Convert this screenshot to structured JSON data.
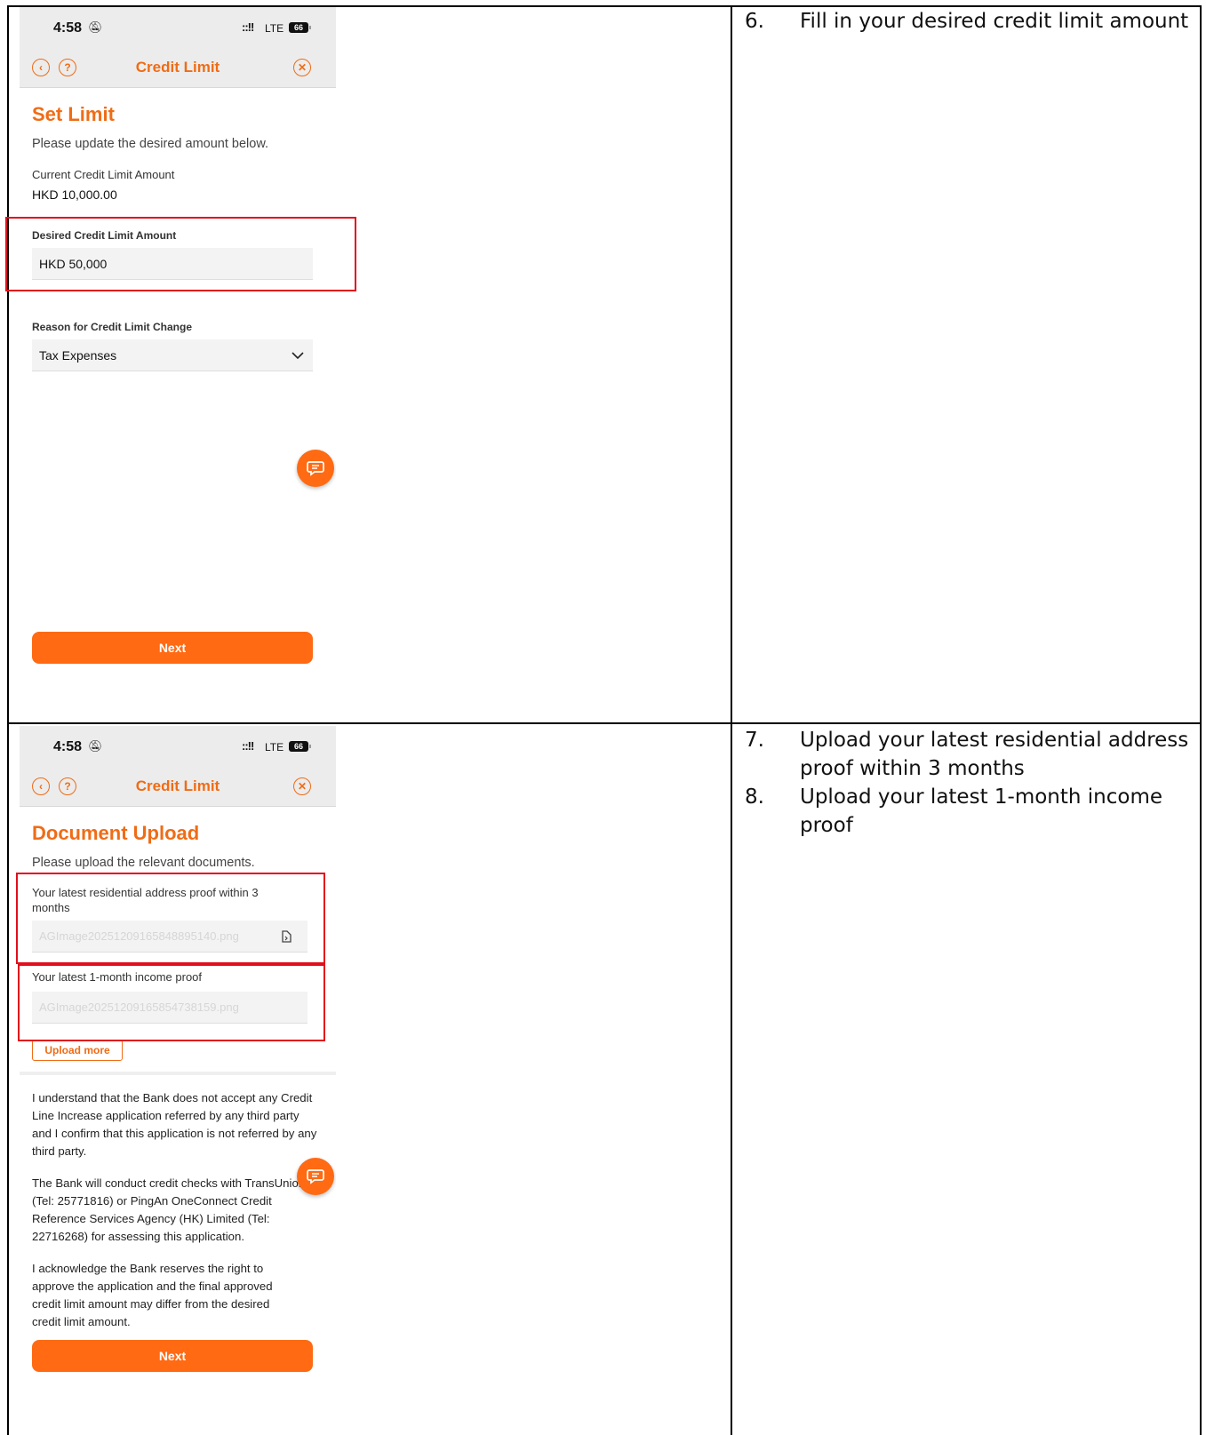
{
  "steps_top": [
    {
      "num": "6.",
      "text": "Fill in your desired credit limit amount"
    }
  ],
  "steps_bottom": [
    {
      "num": "7.",
      "text": "Upload your latest residential address proof within 3 months"
    },
    {
      "num": "8.",
      "text": "Upload your latest 1-month income proof"
    }
  ],
  "status": {
    "time": "4:58",
    "network": "LTE",
    "battery": "66"
  },
  "screen1": {
    "nav_title": "Credit Limit",
    "heading": "Set Limit",
    "subtitle": "Please update the desired amount below.",
    "current_label": "Current Credit Limit Amount",
    "current_value": "HKD 10,000.00",
    "desired_label": "Desired Credit Limit Amount",
    "desired_value": "HKD  50,000",
    "reason_label": "Reason for Credit Limit Change",
    "reason_value": "Tax Expenses",
    "next_label": "Next"
  },
  "screen2": {
    "nav_title": "Credit Limit",
    "heading": "Document Upload",
    "subtitle": "Please upload the relevant documents.",
    "address_label": "Your latest residential address proof within 3 months",
    "address_file": "AGImage20251209165848895140.png",
    "income_label": "Your latest 1-month income proof",
    "income_file": "AGImage20251209165854738159.png",
    "upload_more": "Upload more",
    "para1": "I understand that the Bank does not accept any Credit Line Increase application referred by any third party and I confirm that this application is not referred by any third party.",
    "para2": "The Bank will conduct credit checks with TransUnion (Tel: 25771816) or PingAn OneConnect Credit Reference Services Agency (HK) Limited (Tel: 22716268) for assessing this application.",
    "para3": "I acknowledge the Bank reserves the right to approve the application and the final approved credit limit amount may differ from the desired credit limit amount.",
    "next_label": "Next"
  },
  "colors": {
    "accent": "#ff6a13",
    "highlight": "#e10f1c"
  }
}
